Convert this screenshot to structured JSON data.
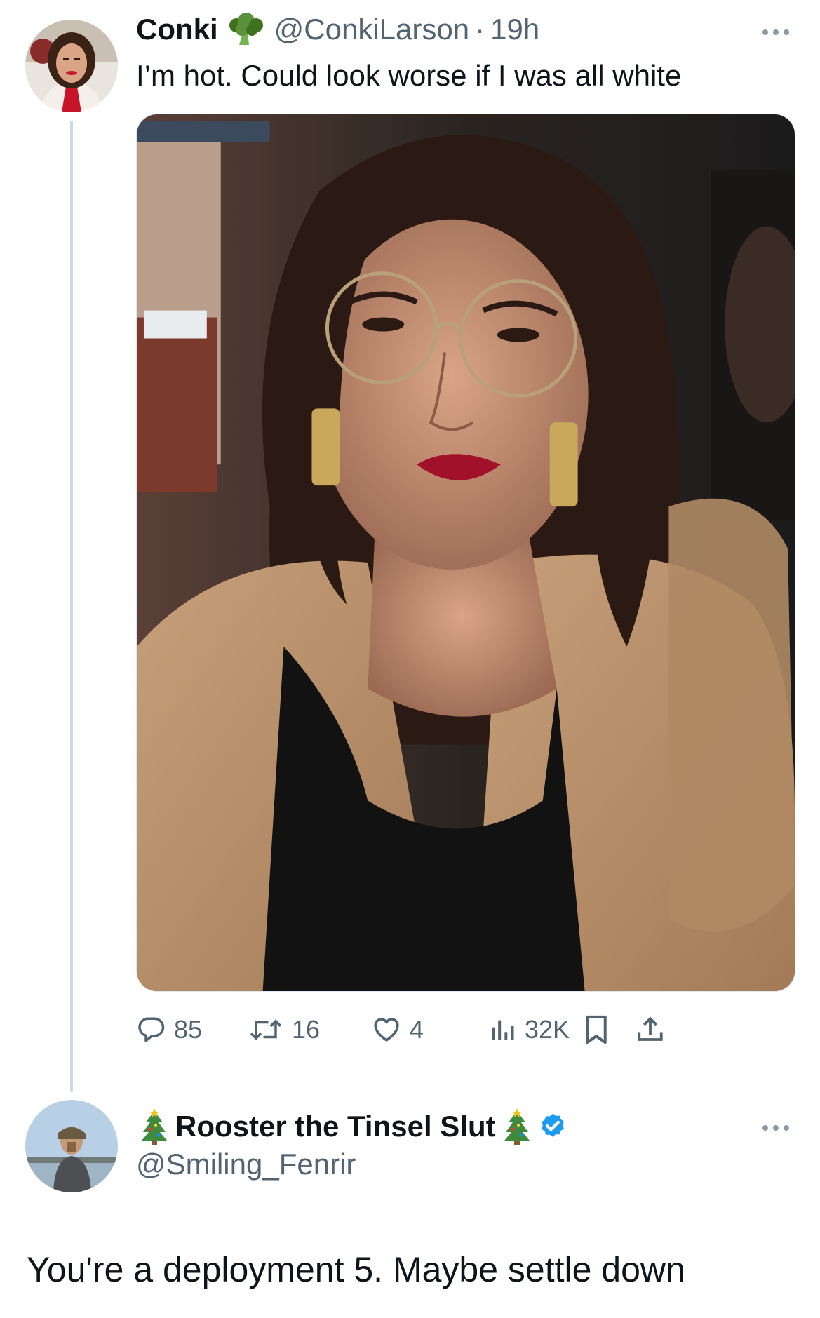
{
  "tweet": {
    "author": {
      "display_name": "Conki",
      "name_emoji_icon": "broccoli-icon",
      "handle": "@ConkiLarson",
      "separator": "·",
      "timestamp": "19h"
    },
    "text": "I’m hot. Could look worse if I was all white",
    "media": {
      "type": "photo"
    },
    "stats": {
      "replies": "85",
      "retweets": "16",
      "likes": "4",
      "views": "32K"
    },
    "icons": {
      "reply": "reply-icon",
      "retweet": "retweet-icon",
      "like": "heart-icon",
      "views": "views-icon",
      "bookmark": "bookmark-icon",
      "share": "share-icon",
      "more": "more-icon"
    }
  },
  "reply": {
    "author": {
      "display_name": "Rooster the Tinsel Slut",
      "name_emoji_icon": "christmas-tree-icon",
      "handle": "@Smiling_Fenrir",
      "verified": true
    },
    "text": "You're a deployment 5. Maybe settle down"
  },
  "colors": {
    "text_primary": "#0f1419",
    "text_secondary": "#536471",
    "thread_line": "#cfd9de",
    "verified_badge": "#1d9bf0",
    "background": "#ffffff"
  }
}
